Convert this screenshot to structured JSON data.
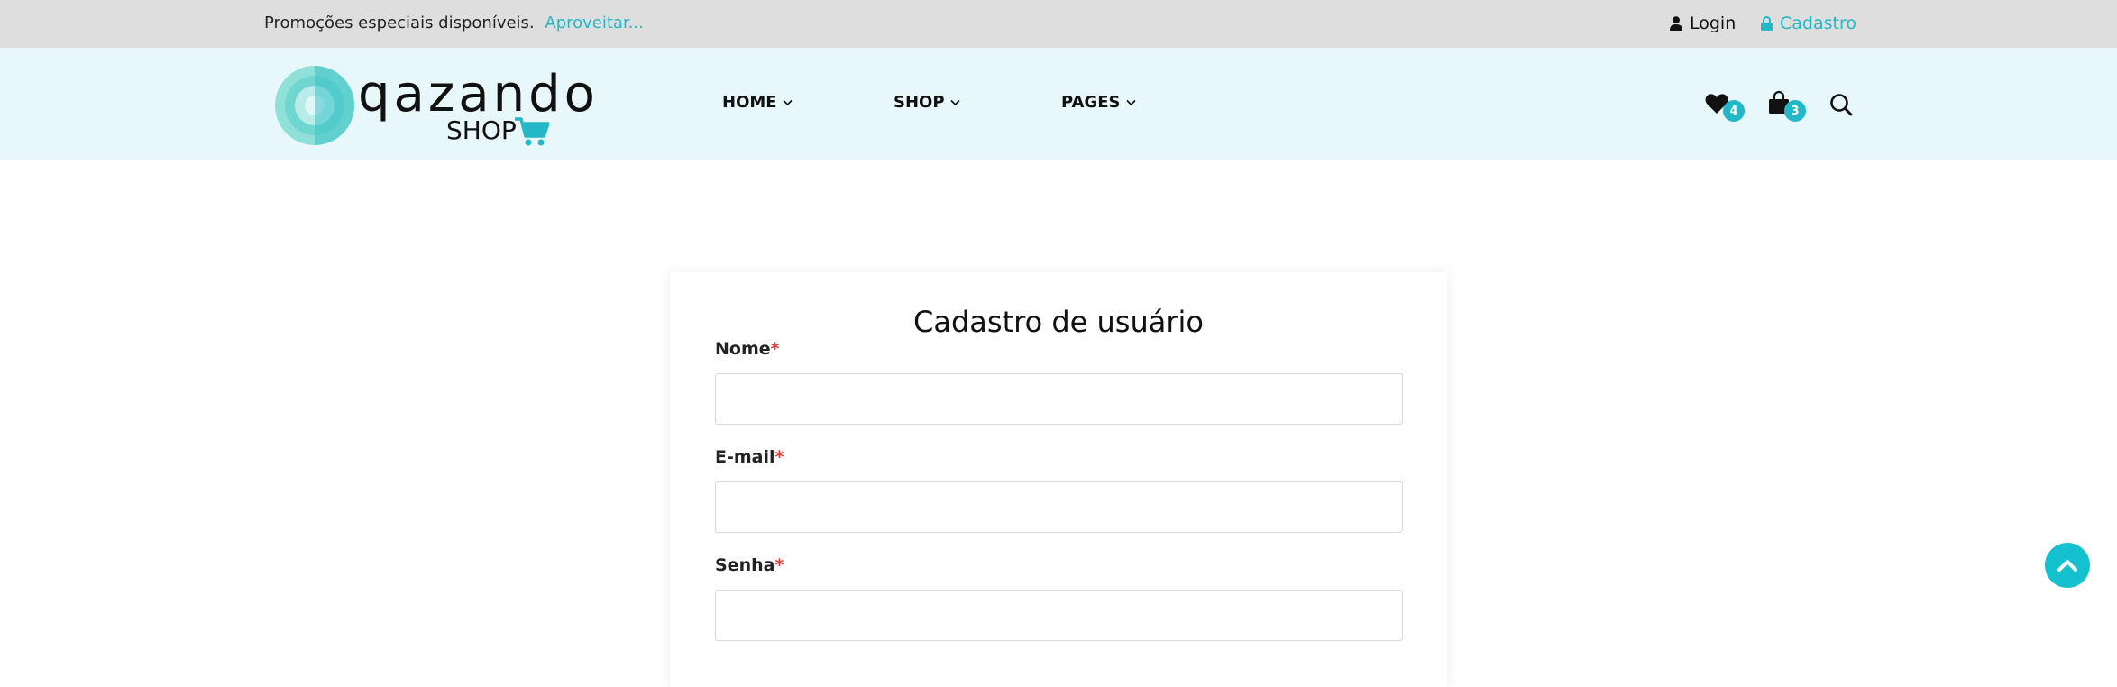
{
  "topbar": {
    "promo_text": "Promoções especiais disponíveis.",
    "promo_link": "Aproveitar...",
    "login_label": "Login",
    "signup_label": "Cadastro"
  },
  "header": {
    "logo_wordmark": "qazando",
    "logo_sub": "SHOP",
    "nav": [
      {
        "label": "HOME"
      },
      {
        "label": "SHOP"
      },
      {
        "label": "PAGES"
      }
    ],
    "wishlist_count": "4",
    "cart_count": "3"
  },
  "form": {
    "title": "Cadastro de usuário",
    "fields": [
      {
        "label": "Nome",
        "required_mark": "*",
        "value": "",
        "placeholder": ""
      },
      {
        "label": "E-mail",
        "required_mark": "*",
        "value": "",
        "placeholder": ""
      },
      {
        "label": "Senha",
        "required_mark": "*",
        "value": "",
        "placeholder": ""
      }
    ]
  },
  "colors": {
    "accent": "#22b8c8",
    "topbar_bg": "#dedede",
    "header_bg": "#e7f7fa",
    "required": "#e53935"
  },
  "icons": [
    "user-icon",
    "lock-icon",
    "chevron-down-icon",
    "heart-icon",
    "shopping-bag-icon",
    "search-icon",
    "cart-icon",
    "chevron-up-icon"
  ]
}
